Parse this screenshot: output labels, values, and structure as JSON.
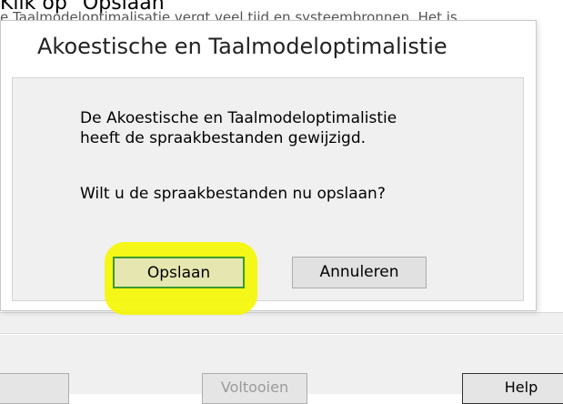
{
  "instruction": "Klik op \"Opslaan\"",
  "background": {
    "text_line": "e Taalmodeloptimalisatie vergt veel tijd en systeembronnen. Het is",
    "button_left": "",
    "button_mid": "Voltooien",
    "button_right": "Help"
  },
  "dialog": {
    "title": "Akoestische en Taalmodeloptimalistie",
    "message_line1": "De Akoestische en Taalmodeloptimalistie",
    "message_line2": "heeft de spraakbestanden gewijzigd.",
    "question": "Wilt u de spraakbestanden nu opslaan?",
    "buttons": {
      "save": "Opslaan",
      "cancel": "Annuleren"
    }
  },
  "colors": {
    "highlight": "#f5f700",
    "focus_border": "#3c9a2c"
  }
}
